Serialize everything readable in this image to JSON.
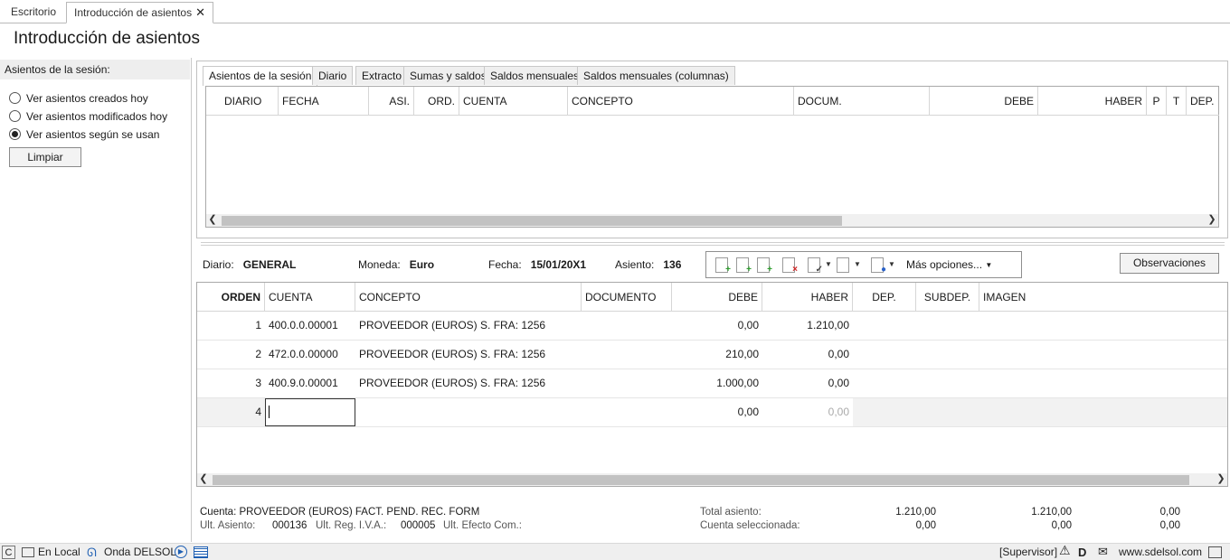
{
  "tabs": [
    {
      "label": "Escritorio",
      "active": false
    },
    {
      "label": "Introducción de asientos",
      "active": true
    }
  ],
  "page_title": "Introducción de asientos",
  "left_panel": {
    "header": "Asientos de la sesión:",
    "options": [
      {
        "label": "Ver asientos creados hoy",
        "selected": false
      },
      {
        "label": "Ver asientos modificados hoy",
        "selected": false
      },
      {
        "label": "Ver asientos según se usan",
        "selected": true
      }
    ],
    "clear_button": "Limpiar"
  },
  "upper": {
    "tabs": [
      "Asientos de la sesión",
      "Diario",
      "Extracto",
      "Sumas y saldos",
      "Saldos mensuales",
      "Saldos mensuales (columnas)"
    ],
    "columns": [
      "DIARIO",
      "FECHA",
      "ASI.",
      "ORD.",
      "CUENTA",
      "CONCEPTO",
      "DOCUM.",
      "DEBE",
      "HABER",
      "P",
      "T",
      "DEP."
    ]
  },
  "entry": {
    "diario_label": "Diario:",
    "diario_value": "GENERAL",
    "moneda_label": "Moneda:",
    "moneda_value": "Euro",
    "fecha_label": "Fecha:",
    "fecha_value": "15/01/20X1",
    "asiento_label": "Asiento:",
    "asiento_value": "136",
    "more_options": "Más opciones...",
    "observaciones": "Observaciones"
  },
  "toolbar_icons": [
    "new-line-icon",
    "insert-line-icon",
    "add-line-icon",
    "delete-line-icon",
    "check-list-icon",
    "copy-icon",
    "view-icon"
  ],
  "lines": {
    "columns": [
      "ORDEN",
      "CUENTA",
      "CONCEPTO",
      "DOCUMENTO",
      "DEBE",
      "HABER",
      "DEP.",
      "SUBDEP.",
      "IMAGEN"
    ],
    "rows": [
      {
        "orden": "1",
        "cuenta": "400.0.0.00001",
        "concepto": "PROVEEDOR (EUROS) S. FRA:  1256",
        "debe": "0,00",
        "haber": "1.210,00"
      },
      {
        "orden": "2",
        "cuenta": "472.0.0.00000",
        "concepto": "PROVEEDOR (EUROS) S. FRA:  1256",
        "debe": "210,00",
        "haber": "0,00"
      },
      {
        "orden": "3",
        "cuenta": "400.9.0.00001",
        "concepto": "PROVEEDOR (EUROS) S. FRA:  1256",
        "debe": "1.000,00",
        "haber": "0,00"
      },
      {
        "orden": "4",
        "cuenta": "",
        "concepto": "",
        "debe": "0,00",
        "haber": "0,00"
      }
    ]
  },
  "footer": {
    "cuenta": "Cuenta: PROVEEDOR (EUROS) FACT. PEND. REC. FORM",
    "ult_asiento_label": "Ult. Asiento:",
    "ult_asiento": "000136",
    "ult_reg_iva_label": "Ult. Reg. I.V.A.:",
    "ult_reg_iva": "000005",
    "ult_efecto_label": "Ult. Efecto Com.:",
    "total_label": "Total asiento:",
    "total_debe": "1.210,00",
    "total_haber": "1.210,00",
    "total_saldo": "0,00",
    "sel_label": "Cuenta seleccionada:",
    "sel_debe": "0,00",
    "sel_haber": "0,00",
    "sel_saldo": "0,00"
  },
  "statusbar": {
    "c_label": "C",
    "local": "En Local",
    "onda": "Onda DELSOL",
    "supervisor": "[Supervisor]",
    "d_label": "D",
    "website": "www.sdelsol.com"
  }
}
